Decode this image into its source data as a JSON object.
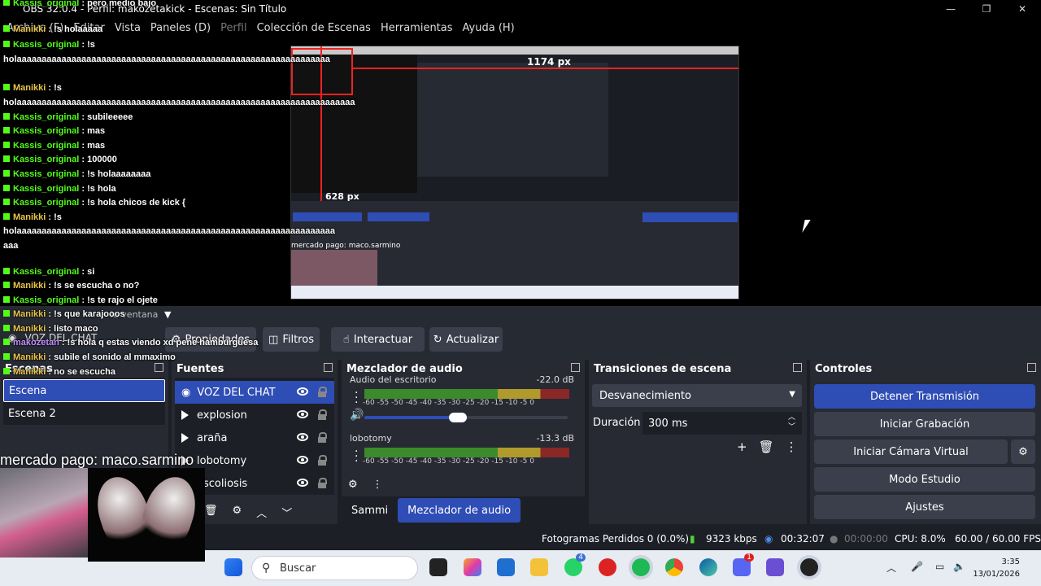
{
  "window": {
    "title": "OBS 32.0.4 - Perfil: makozetakick - Escenas: Sin Título",
    "minimize": "—",
    "maximize": "❐",
    "close": "✕"
  },
  "menu": [
    "Archivo (F)",
    "Editar",
    "Vista",
    "Paneles (D)",
    "Perfil",
    "Colección de Escenas",
    "Herramientas",
    "Ayuda (H)"
  ],
  "chat": [
    {
      "user": "Kassis_original",
      "msg": "pero medio bajo",
      "u": "u1"
    },
    {
      "user": "Manikki",
      "msg": "!s holaaaaa",
      "u": "u2"
    },
    {
      "user": "Kassis_original",
      "msg": "!s holaaaaaaaaaaaaaaaaaaaaaaaaaaaaaaaaaaaaaaaaaaaaaaaaaaaaaaaaaaaaaaa",
      "u": "u1"
    },
    {
      "user": "Manikki",
      "msg": "!s holaaaaaaaaaaaaaaaaaaaaaaaaaaaaaaaaaaaaaaaaaaaaaaaaaaaaaaaaaaaaaaaaaaaa",
      "u": "u2"
    },
    {
      "user": "Kassis_original",
      "msg": "subileeeee",
      "u": "u1"
    },
    {
      "user": "Kassis_original",
      "msg": "mas",
      "u": "u1"
    },
    {
      "user": "Kassis_original",
      "msg": "mas",
      "u": "u1"
    },
    {
      "user": "Kassis_original",
      "msg": "100000",
      "u": "u1"
    },
    {
      "user": "Kassis_original",
      "msg": "!s holaaaaaaaa",
      "u": "u1"
    },
    {
      "user": "Kassis_original",
      "msg": "!s hola",
      "u": "u1"
    },
    {
      "user": "Kassis_original",
      "msg": "!s hola chicos de kick {",
      "u": "u1"
    },
    {
      "user": "Manikki",
      "msg": "!s holaaaaaaaaaaaaaaaaaaaaaaaaaaaaaaaaaaaaaaaaaaaaaaaaaaaaaaaaaaaaaaaa aaa",
      "u": "u2"
    },
    {
      "user": "Kassis_original",
      "msg": "si",
      "u": "u1"
    },
    {
      "user": "Manikki",
      "msg": "!s se escucha o no?",
      "u": "u2"
    },
    {
      "user": "Kassis_original",
      "msg": "!s te rajo el ojete",
      "u": "u1"
    },
    {
      "user": "Manikki",
      "msg": "!s que karajooos",
      "u": "u2"
    },
    {
      "user": "Manikki",
      "msg": "listo maco",
      "u": "u2"
    },
    {
      "user": "makozetan",
      "msg": "!s hola q estas viendo xd pene hamburguesa",
      "u": "u3"
    },
    {
      "user": "Manikki",
      "msg": "subile el sonido al mmaximo",
      "u": "u2"
    },
    {
      "user": "Manikki",
      "msg": "no se escucha",
      "u": "u2"
    }
  ],
  "preview": {
    "label_width": "1174 px",
    "label_height": "628 px",
    "label_mercado": "mercado pago: maco.sarmino"
  },
  "source_bar": {
    "source_name": "VOZ DEL CHAT",
    "window_label": "la ventana"
  },
  "toolbar": {
    "properties": "Propiedades",
    "filters": "Filtros",
    "interact": "Interactuar",
    "refresh": "Actualizar"
  },
  "scenes": {
    "title": "Escenas",
    "items": [
      "Escena",
      "Escena 2"
    ]
  },
  "sources": {
    "title": "Fuentes",
    "items": [
      "VOZ DEL CHAT",
      "explosion",
      "araña",
      "lobotomy",
      "escoliosis"
    ]
  },
  "mixer": {
    "title": "Mezclador de audio",
    "channels": [
      {
        "name": "Audio del escritorio",
        "db": "-22.0 dB"
      },
      {
        "name": "lobotomy",
        "db": "-13.3 dB"
      }
    ],
    "ticks": [
      "-60",
      "-55",
      "-50",
      "-45",
      "-40",
      "-35",
      "-30",
      "-25",
      "-20",
      "-15",
      "-10",
      "-5",
      "0"
    ],
    "tabs": [
      "Sammi",
      "Mezclador de audio"
    ]
  },
  "transitions": {
    "title": "Transiciones de escena",
    "selected": "Desvanecimiento",
    "duration_label": "Duración",
    "duration_value": "300 ms"
  },
  "controls": {
    "title": "Controles",
    "stop_stream": "Detener Transmisión",
    "start_recording": "Iniciar Grabación",
    "start_virtualcam": "Iniciar Cámara Virtual",
    "studio_mode": "Modo Estudio",
    "settings": "Ajustes"
  },
  "status": {
    "dropped": "Fotogramas Perdidos 0 (0.0%)",
    "bitrate": "9323 kbps",
    "stream_time": "00:32:07",
    "rec_time": "00:00:00",
    "cpu": "CPU: 8.0%",
    "fps": "60.00 / 60.00 FPS"
  },
  "overlay": {
    "donation": "mercado pago: maco.sarmino"
  },
  "taskbar": {
    "search_placeholder": "Buscar",
    "time": "3:35",
    "date": "13/01/2026",
    "whatsapp_badge": "4",
    "discord_badge": "1"
  },
  "colors": {
    "accent": "#2e4db5",
    "dock_bg": "#272a33",
    "kick_green": "#53fc18"
  }
}
